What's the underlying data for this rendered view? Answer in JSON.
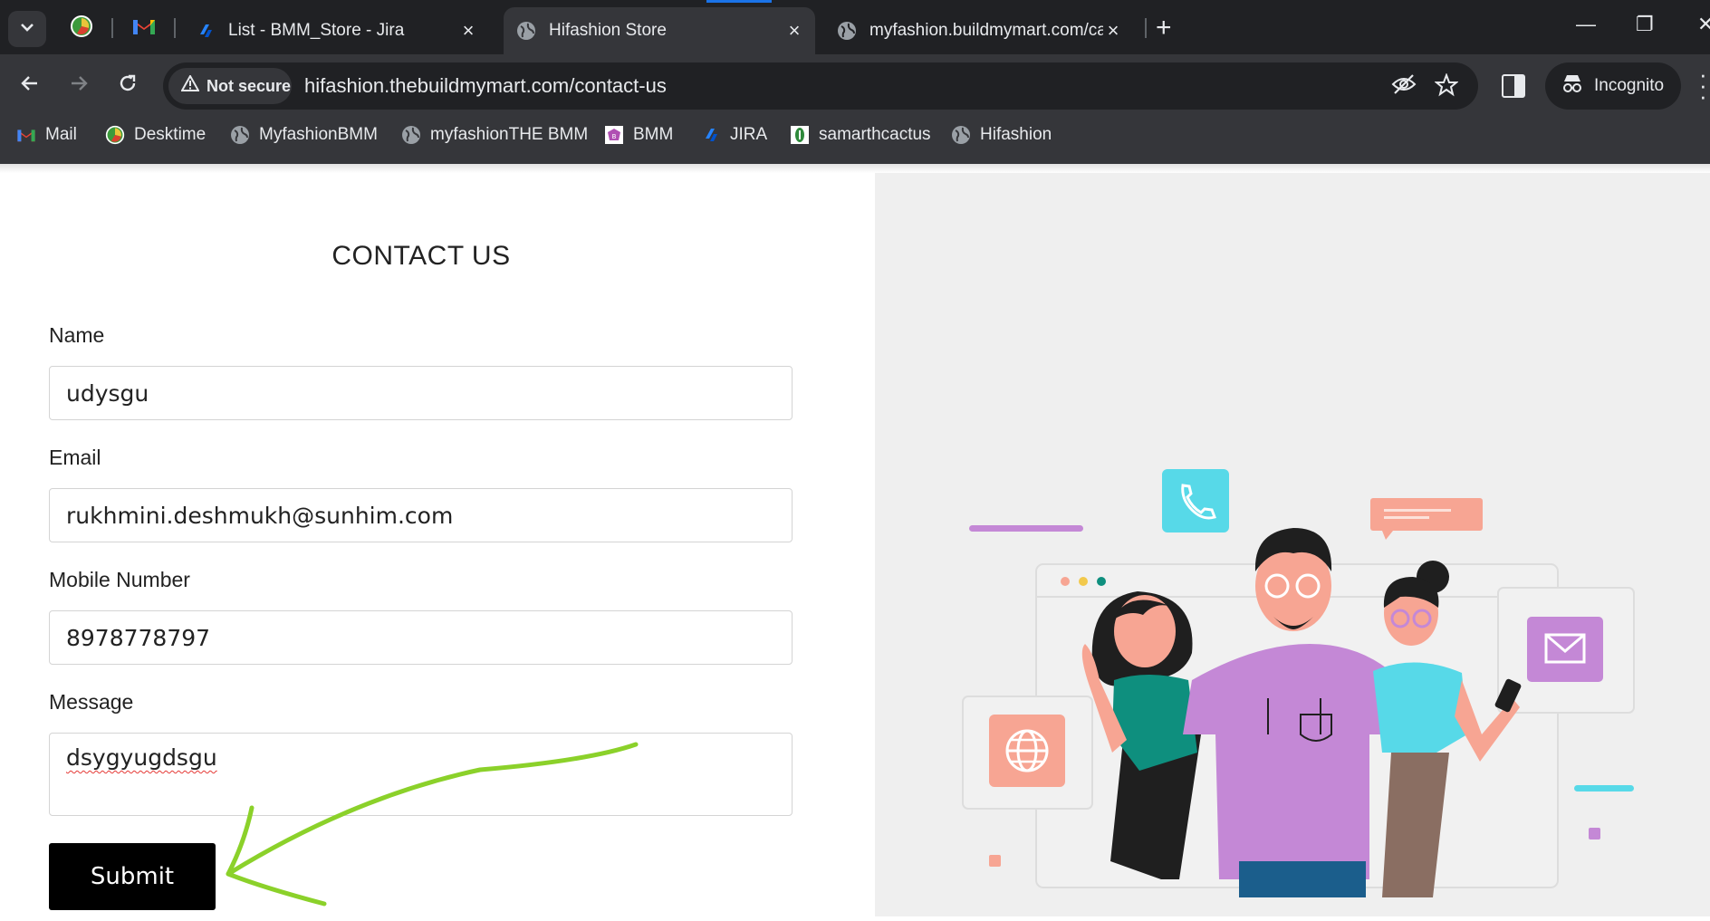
{
  "browser": {
    "tabs": [
      {
        "title": "List - BMM_Store - Jira",
        "close": "×"
      },
      {
        "title": "Hifashion Store",
        "close": "×",
        "active": true
      },
      {
        "title": "myfashion.buildmymart.com/ca",
        "close": "×"
      }
    ],
    "new_tab": "+",
    "window_controls": {
      "minimize": "—",
      "restore": "❐",
      "close": "✕"
    },
    "security_label": "Not secure",
    "url": "hifashion.thebuildmymart.com/contact-us",
    "incognito_label": "Incognito",
    "bookmarks": [
      {
        "label": "Mail",
        "icon": "gmail-icon"
      },
      {
        "label": "Desktime",
        "icon": "desktime-icon"
      },
      {
        "label": "MyfashionBMM",
        "icon": "globe-icon"
      },
      {
        "label": "myfashionTHE BMM",
        "icon": "globe-icon"
      },
      {
        "label": "BMM",
        "icon": "bmm-icon"
      },
      {
        "label": "JIRA",
        "icon": "jira-icon"
      },
      {
        "label": "samarthcactus",
        "icon": "cactus-icon"
      },
      {
        "label": "Hifashion",
        "icon": "globe-icon"
      }
    ]
  },
  "form": {
    "title": "CONTACT US",
    "name_label": "Name",
    "name_value": "udysgu",
    "email_label": "Email",
    "email_value": "rukhmini.deshmukh@sunhim.com",
    "mobile_label": "Mobile Number",
    "mobile_value": "8978778797",
    "message_label": "Message",
    "message_value": "dsygyugdsgu",
    "submit_label": "Submit"
  },
  "colors": {
    "chrome_dark": "#202124",
    "chrome_toolbar": "#35363a",
    "accent_arrow": "#8bd12a",
    "submit_bg": "#000000",
    "illustration_bg": "#efefef"
  }
}
